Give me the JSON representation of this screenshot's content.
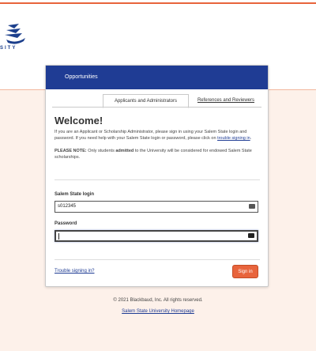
{
  "logo": {
    "word": "SITY",
    "icon": "salem-state-logo"
  },
  "header": {
    "title": "Opportunities"
  },
  "tabs": [
    {
      "label": "Applicants and Administrators"
    },
    {
      "label": "References and Reviewers"
    }
  ],
  "welcome": {
    "title": "Welcome!",
    "intro": "If you are an Applicant or Scholarship Administrator, please sign in using your Salem State login and password. If you need help with your Salem State login or password, please click on",
    "intro_link": "trouble signing in",
    "note_label": "PLEASE NOTE:",
    "note_text_1": "Only students",
    "note_bold": "admitted",
    "note_text_2": "to the University will be considered for endowed Salem State scholarships."
  },
  "login": {
    "label": "Salem State login",
    "value": "s012345"
  },
  "password": {
    "label": "Password",
    "value": ""
  },
  "actions": {
    "trouble_link": "Trouble signing in?",
    "signin_label": "Sign in"
  },
  "footer": {
    "copyright": "© 2021 Blackbaud, Inc. All rights reserved.",
    "homepage_link": "Salem State University Homepage"
  },
  "colors": {
    "accent": "#e8643c",
    "header": "#1f3c94",
    "band": "#fdf1ea"
  }
}
